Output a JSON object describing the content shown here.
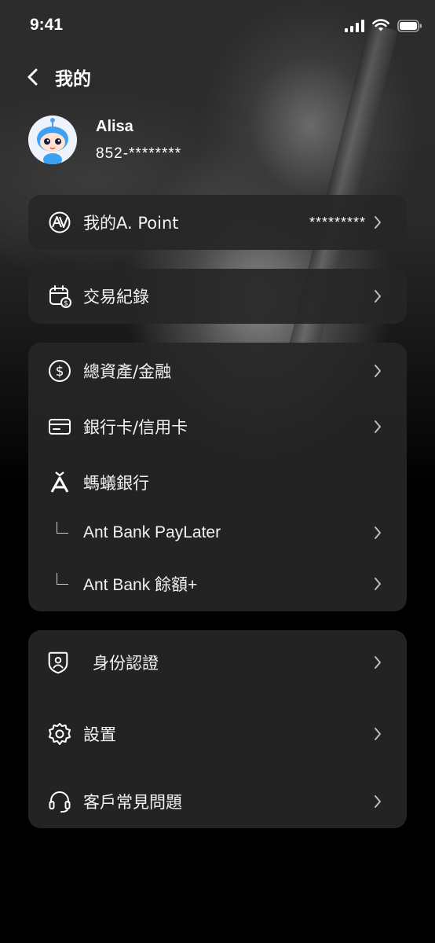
{
  "status_bar": {
    "time": "9:41"
  },
  "nav": {
    "title": "我的"
  },
  "profile": {
    "name": "Alisa",
    "phone": "852-********"
  },
  "points": {
    "label": "我的A. Point",
    "value": "*********"
  },
  "transactions": {
    "label": "交易紀錄"
  },
  "finance": {
    "assets": "總資產/金融",
    "cards": "銀行卡/信用卡",
    "ant_bank": "螞蟻銀行",
    "paylater": "Ant Bank PayLater",
    "balance_plus": "Ant Bank 餘額+"
  },
  "settings_card": {
    "identity": "身份認證",
    "settings": "設置",
    "faq": "客戶常見問題"
  },
  "icons": {
    "back": "chevron-left-icon",
    "apoint": "apoint-icon",
    "calendar": "calendar-dollar-icon",
    "dollar": "dollar-circle-icon",
    "card": "credit-card-icon",
    "antbank": "ant-bank-logo-icon",
    "shield": "shield-user-icon",
    "gear": "gear-icon",
    "headset": "headset-icon"
  }
}
